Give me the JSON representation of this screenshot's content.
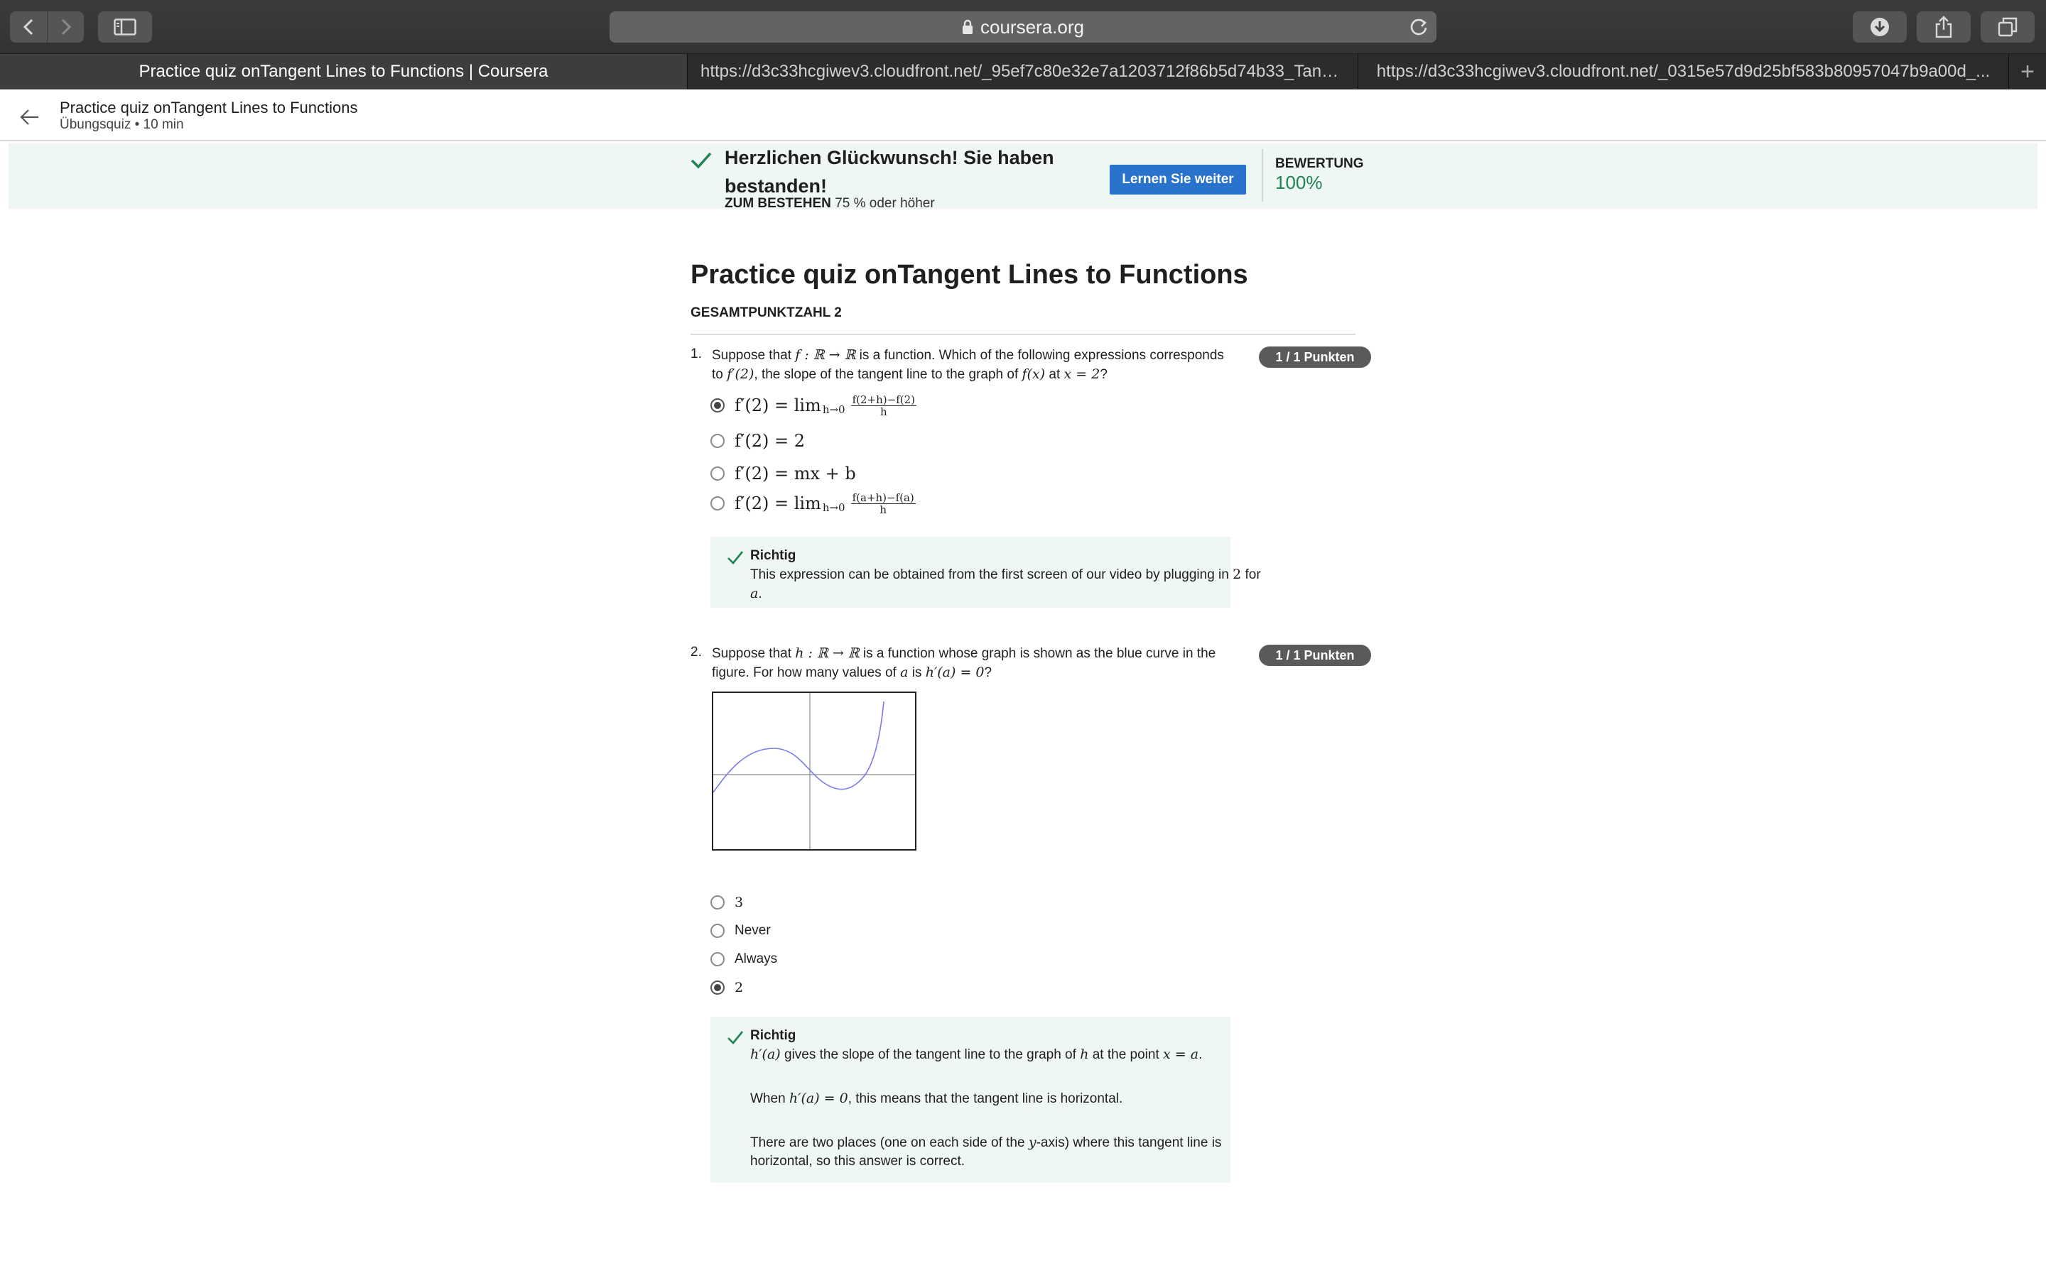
{
  "browser": {
    "address": "coursera.org",
    "tabs": [
      {
        "label": "Practice quiz onTangent Lines to Functions | Coursera",
        "active": true
      },
      {
        "label": "https://d3c33hcgiwev3.cloudfront.net/_95ef7c80e32e7a1203712f86b5d74b33_Tang...",
        "active": false
      },
      {
        "label": "https://d3c33hcgiwev3.cloudfront.net/_0315e57d9d25bf583b80957047b9a00d_...",
        "active": false
      }
    ]
  },
  "header": {
    "title": "Practice quiz onTangent Lines to Functions",
    "subtitle": "Übungsquiz • 10 min"
  },
  "banner": {
    "title": "Herzlichen Glückwunsch! Sie haben bestanden!",
    "pass_label": "ZUM BESTEHEN",
    "pass_value": "75 % oder höher",
    "continue_button": "Lernen Sie weiter",
    "grade_label": "BEWERTUNG",
    "grade_value": "100%"
  },
  "quiz": {
    "title": "Practice quiz onTangent Lines to Functions",
    "total": "GESAMTPUNKTZAHL 2"
  },
  "q1": {
    "number": "1.",
    "text_a": "Suppose that",
    "text_math_a": "f : ℝ → ℝ",
    "text_b": "is a function. Which of the following expressions corresponds",
    "text_c": "to",
    "text_math_b": "f′(2)",
    "text_d": ", the slope of the tangent line to the graph of",
    "text_math_c": "f(x)",
    "text_e": "at",
    "text_math_d": "x = 2",
    "text_f": "?",
    "badge": "1 / 1 Punkten",
    "options": [
      {
        "main": "f′(2) = lim",
        "sub": "h→0",
        "num": "f(2+h)−f(2)",
        "den": "h",
        "selected": true
      },
      {
        "main": "f′(2) = 2",
        "selected": false
      },
      {
        "main": "f′(2) = mx + b",
        "selected": false
      },
      {
        "main": "f′(2) = lim",
        "sub": "h→0",
        "num": "f(a+h)−f(a)",
        "den": "h",
        "selected": false
      }
    ],
    "feedback_title": "Richtig",
    "feedback_a": "This expression can be obtained from the first screen of our video by plugging in",
    "feedback_math": "2",
    "feedback_b": "for",
    "feedback_math_b": "a",
    "feedback_c": "."
  },
  "q2": {
    "number": "2.",
    "text_a": "Suppose that",
    "text_math_a": "h : ℝ → ℝ",
    "text_b": "is a function whose graph is shown as the blue curve in the",
    "text_c": "figure. For how many values of",
    "text_math_b": "a",
    "text_d": "is",
    "text_math_c": "h′(a) = 0",
    "text_e": "?",
    "badge": "1 / 1 Punkten",
    "options": [
      {
        "label": "3",
        "selected": false
      },
      {
        "label": "Never",
        "selected": false
      },
      {
        "label": "Always",
        "selected": false
      },
      {
        "label": "2",
        "selected": true
      }
    ],
    "feedback_title": "Richtig",
    "fb1_math_a": "h′(a)",
    "fb1_a": "gives the slope of the tangent line to the graph of",
    "fb1_math_b": "h",
    "fb1_b": "at the point",
    "fb1_math_c": "x = a",
    "fb1_c": ".",
    "fb2_a": "When",
    "fb2_math": "h′(a) = 0",
    "fb2_b": ", this means that the tangent line is horizontal.",
    "fb3_a": "There are two places (one on each side of the",
    "fb3_math": "y",
    "fb3_b": "-axis) where this tangent line is",
    "fb3_c": "horizontal, so this answer is correct."
  },
  "colors": {
    "accent_blue": "#2a73cc",
    "success_green": "#1f8354",
    "banner_bg": "#eef7f3",
    "curve": "#7b7be8"
  },
  "icons": [
    "back-icon",
    "forward-icon",
    "sidebar-icon",
    "lock-icon",
    "reload-icon",
    "download-icon",
    "share-icon",
    "tabs-icon",
    "arrow-left-icon",
    "check-icon"
  ]
}
